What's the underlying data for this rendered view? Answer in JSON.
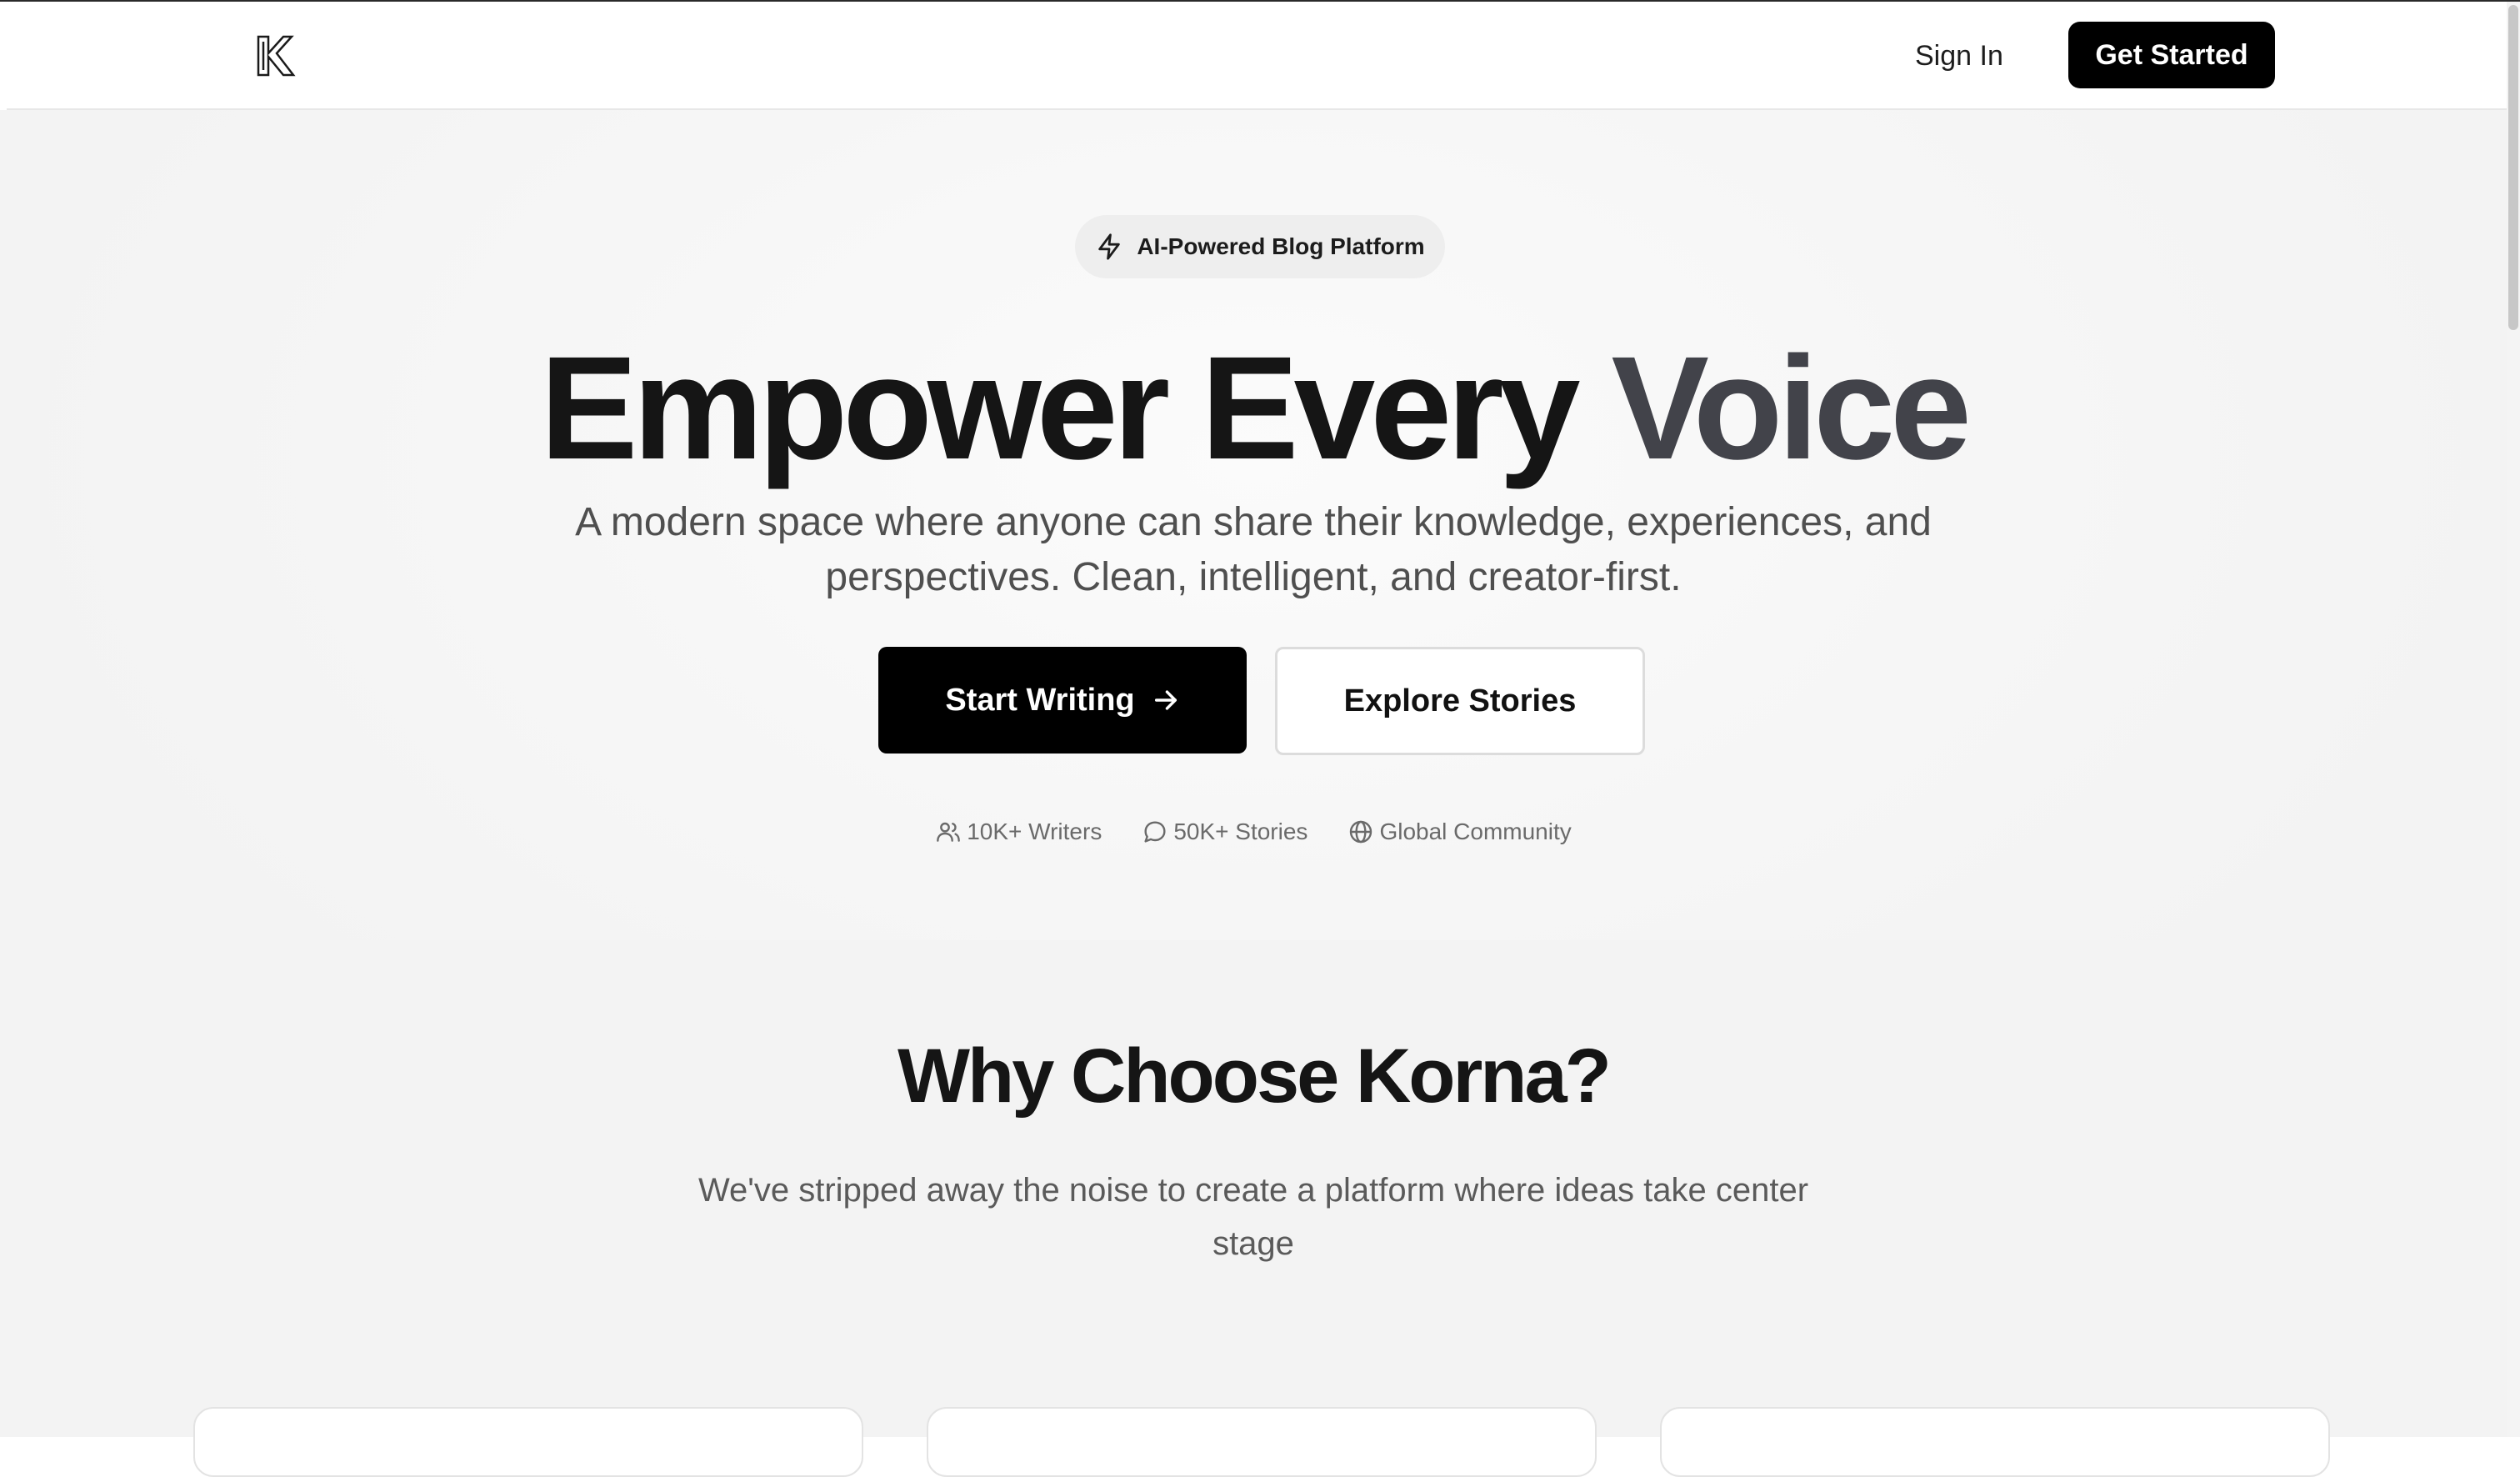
{
  "header": {
    "logo_icon": "korna-k-logo-icon",
    "signin_label": "Sign In",
    "getstarted_label": "Get Started"
  },
  "hero": {
    "badge": {
      "icon": "lightning-bolt-icon",
      "label": "AI-Powered Blog Platform"
    },
    "headline_main": "Empower Every ",
    "headline_accent": "Voice",
    "subhead": "A modern space where anyone can share their knowledge, experiences, and perspectives. Clean, intelligent, and creator-first.",
    "primary_button": {
      "label": "Start Writing",
      "icon": "arrow-right-icon"
    },
    "secondary_button": {
      "label": "Explore Stories"
    },
    "stats": [
      {
        "icon": "users-icon",
        "label": "10K+ Writers"
      },
      {
        "icon": "chat-bubble-icon",
        "label": "50K+ Stories"
      },
      {
        "icon": "globe-icon",
        "label": "Global Community"
      }
    ]
  },
  "features": {
    "title": "Why Choose Korna?",
    "subtitle": "We've stripped away the noise to create a platform where ideas take center stage"
  },
  "colors": {
    "primary": "#000000",
    "accent_headline": "#42434a",
    "text": "#151515",
    "muted": "#4f4f4f",
    "section_bg": "#f3f3f3"
  }
}
